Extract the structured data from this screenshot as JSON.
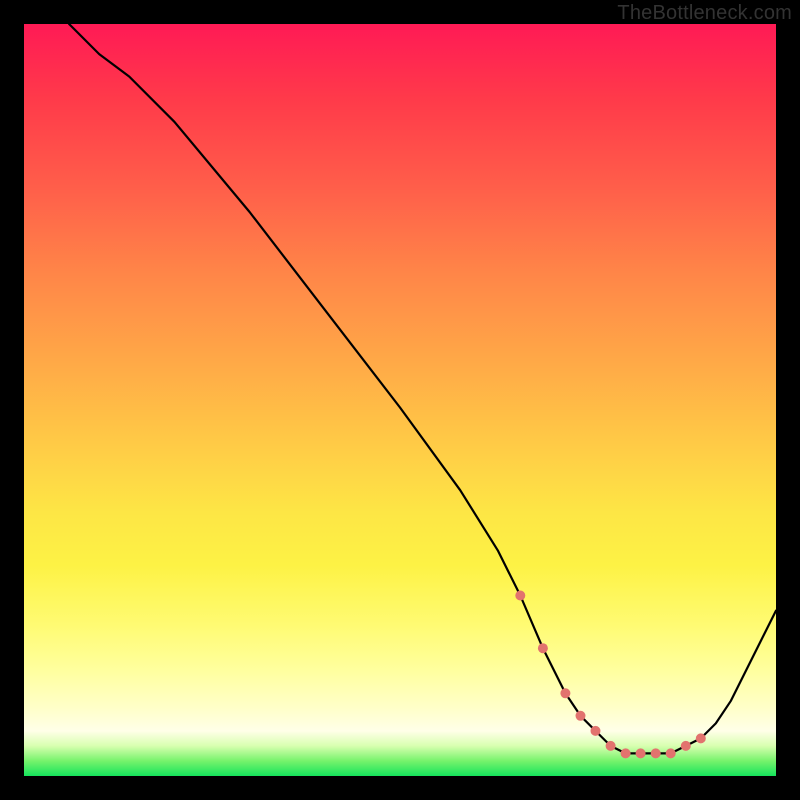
{
  "watermark": "TheBottleneck.com",
  "chart_data": {
    "type": "line",
    "title": "",
    "xlabel": "",
    "ylabel": "",
    "xlim": [
      0,
      100
    ],
    "ylim": [
      0,
      100
    ],
    "series": [
      {
        "name": "curve",
        "x": [
          6,
          10,
          14,
          20,
          30,
          40,
          50,
          58,
          63,
          66,
          69,
          72,
          74,
          76,
          78,
          80,
          82,
          84,
          86,
          88,
          90,
          92,
          94,
          97,
          100
        ],
        "values": [
          100,
          96,
          93,
          87,
          75,
          62,
          49,
          38,
          30,
          24,
          17,
          11,
          8,
          6,
          4,
          3,
          3,
          3,
          3,
          4,
          5,
          7,
          10,
          16,
          22
        ]
      }
    ],
    "markers": {
      "name": "highlight-dots",
      "color": "#e2736e",
      "x": [
        66,
        69,
        72,
        74,
        76,
        78,
        80,
        82,
        84,
        86,
        88,
        90
      ],
      "values": [
        24,
        17,
        11,
        8,
        6,
        4,
        3,
        3,
        3,
        3,
        4,
        5
      ]
    }
  }
}
